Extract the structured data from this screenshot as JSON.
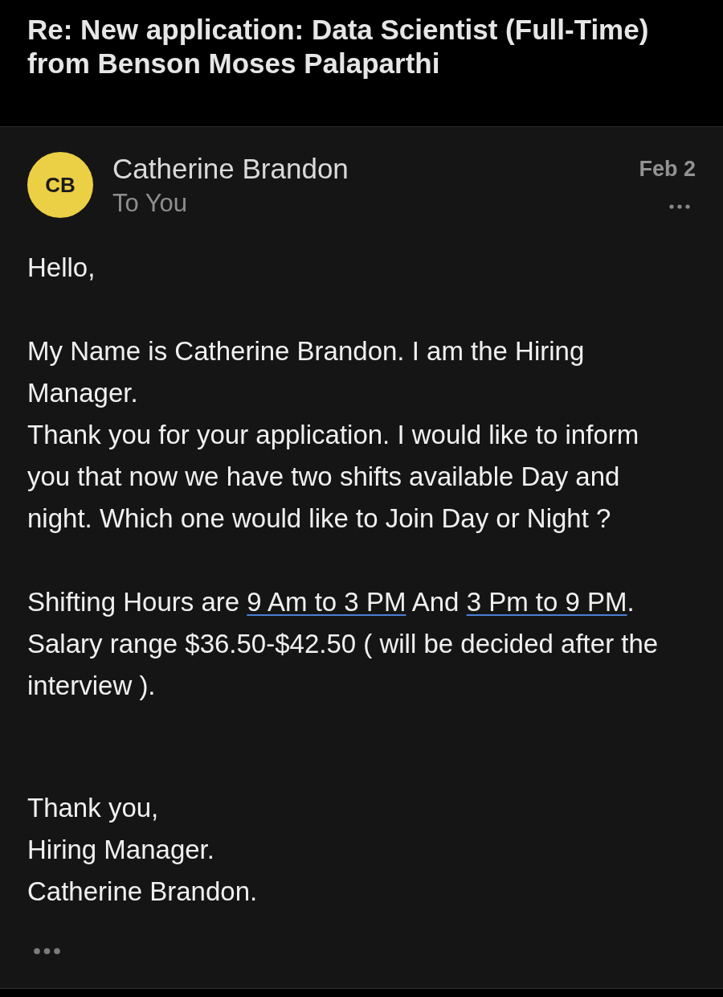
{
  "email": {
    "subject": "Re: New application: Data Scientist (Full-Time) from Benson Moses Palaparthi"
  },
  "message": {
    "sender": {
      "initials": "CB",
      "name": "Catherine Brandon"
    },
    "recipient": "To You",
    "date": "Feb 2",
    "body": [
      {
        "kind": "text",
        "lines": [
          [
            {
              "kind": "text",
              "text": "Hello,"
            }
          ]
        ]
      },
      {
        "kind": "text",
        "lines": [
          [
            {
              "kind": "text",
              "text": "My Name is Catherine Brandon. I am the Hiring Manager."
            }
          ],
          [
            {
              "kind": "text",
              "text": "Thank you for your application. I would like to inform you that now we have two shifts available Day and night. Which one would like to Join Day or Night ?"
            }
          ]
        ]
      },
      {
        "kind": "text",
        "lines": [
          [
            {
              "kind": "text",
              "text": "Shifting Hours are "
            },
            {
              "kind": "link",
              "text": "9 Am to 3 PM"
            },
            {
              "kind": "text",
              "text": " And "
            },
            {
              "kind": "link",
              "text": "3 Pm to 9 PM"
            },
            {
              "kind": "text",
              "text": "."
            }
          ],
          [
            {
              "kind": "text",
              "text": "Salary range $36.50-$42.50 ( will be decided after the interview )."
            }
          ]
        ]
      },
      {
        "kind": "signature",
        "lines": [
          [
            {
              "kind": "text",
              "text": "Thank you,"
            }
          ],
          [
            {
              "kind": "text",
              "text": "Hiring Manager."
            }
          ],
          [
            {
              "kind": "text",
              "text": "Catherine Brandon."
            }
          ]
        ]
      }
    ]
  }
}
